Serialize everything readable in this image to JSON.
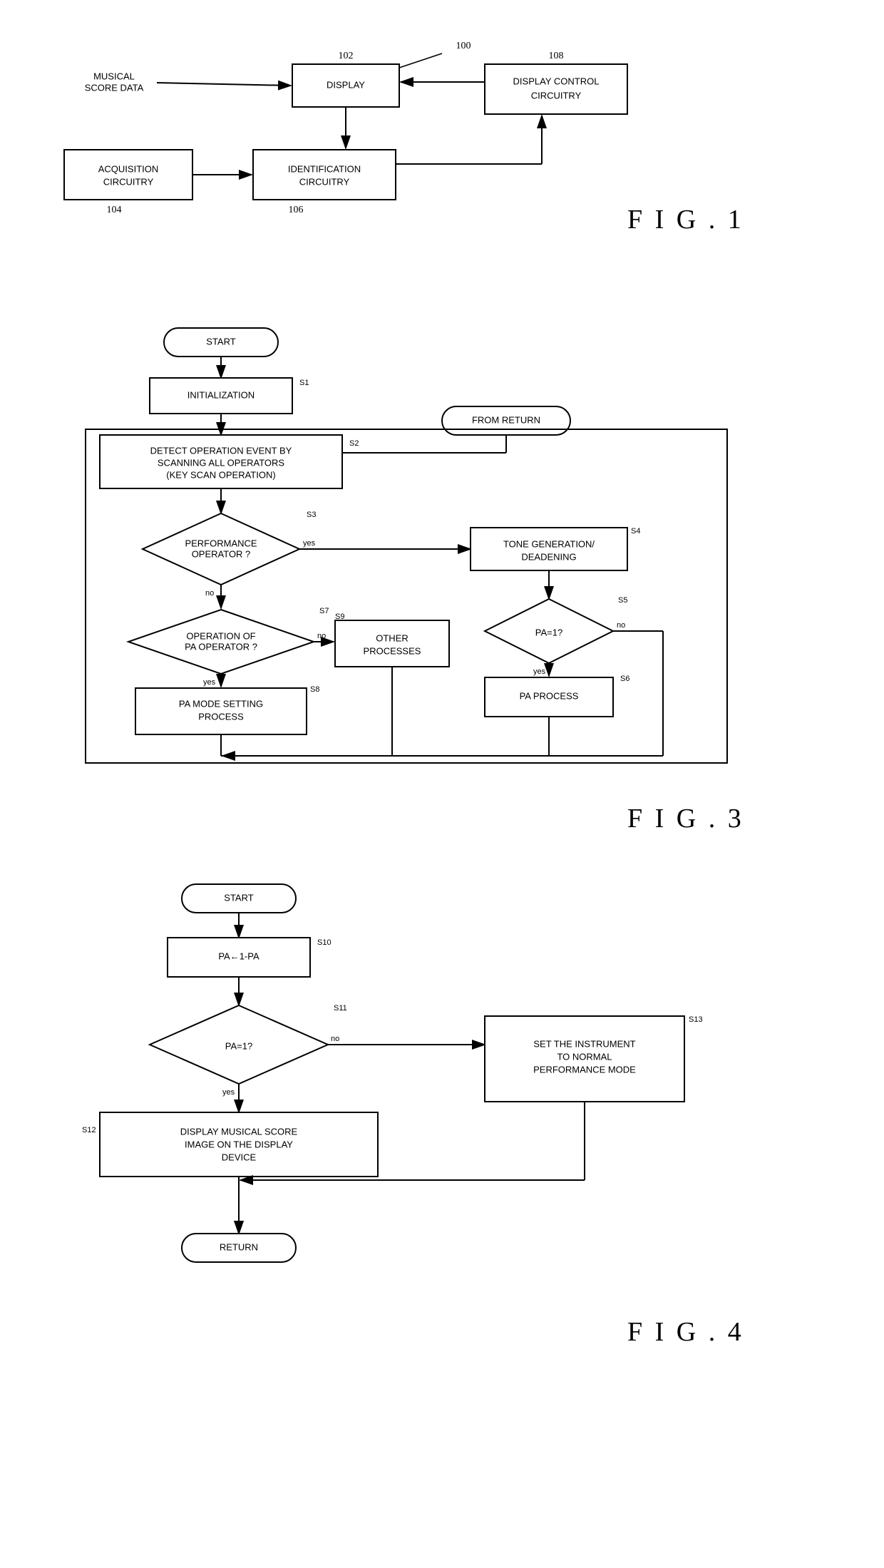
{
  "fig1": {
    "title": "F I G .  1",
    "ref_number": "100",
    "blocks": {
      "display": {
        "label": "DISPLAY",
        "ref": "102"
      },
      "musical_score": {
        "label": "MUSICAL\nSCORE DATA"
      },
      "acquisition": {
        "label": "ACQUISITION\nCIRCUITRY",
        "ref": "104"
      },
      "identification": {
        "label": "IDENTIFICATION\nCIRCUITRY",
        "ref": "106"
      },
      "display_control": {
        "label": "DISPLAY CONTROL\nCIRCUITRY",
        "ref": "108"
      }
    }
  },
  "fig3": {
    "title": "F I G .  3",
    "steps": {
      "start": "START",
      "init": "INITIALIZATION",
      "detect": "DETECT OPERATION EVENT BY\nSCANNING ALL OPERATORS\n(KEY SCAN OPERATION)",
      "perf_op": "PERFORMANCE\nOPERATOR ?",
      "tone_gen": "TONE GENERATION/\nDEADENING",
      "pa_eq1_q": "PA=1?",
      "pa_process": "PA PROCESS",
      "op_pa": "OPERATION OF\nPA OPERATOR ?",
      "pa_mode": "PA MODE SETTING\nPROCESS",
      "other": "OTHER\nPROCESSES",
      "from_return": "FROM RETURN"
    },
    "refs": {
      "s1": "S1",
      "s2": "S2",
      "s3": "S3",
      "s4": "S4",
      "s5": "S5",
      "s6": "S6",
      "s7": "S7",
      "s8": "S8",
      "s9": "S9"
    }
  },
  "fig4": {
    "title": "F I G .  4",
    "steps": {
      "start": "START",
      "pa_assign": "PA←1-PA",
      "pa_eq1_q": "PA=1?",
      "display_score": "DISPLAY MUSICAL SCORE\nIMAGE ON THE DISPLAY\nDEVICE",
      "set_normal": "SET THE INSTRUMENT\nTO NORMAL\nPERFORMANCE MODE",
      "return": "RETURN"
    },
    "refs": {
      "s10": "S10",
      "s11": "S11",
      "s12": "S12",
      "s13": "S13"
    }
  }
}
